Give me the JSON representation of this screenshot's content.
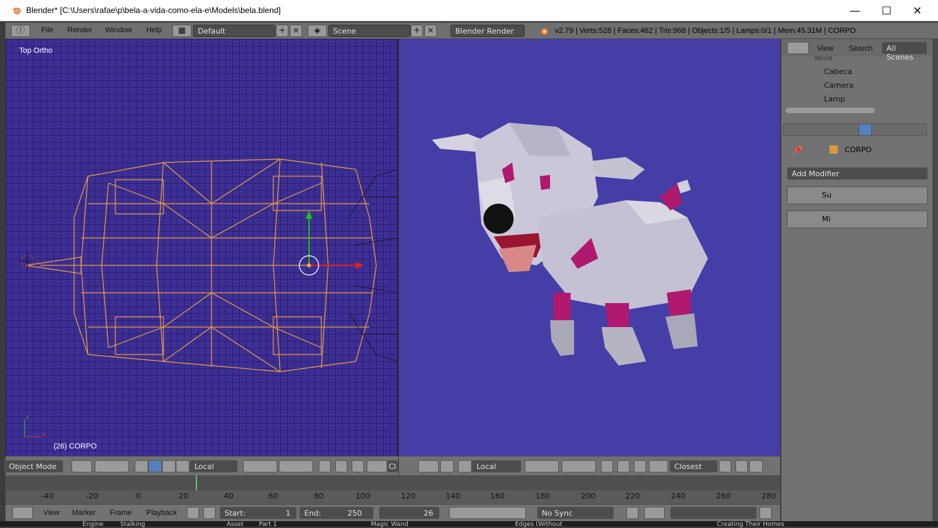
{
  "window": {
    "title": "Blender* [C:\\Users\\rafae\\p\\bela-a-vida-como-ela-e\\Models\\bela.blend]",
    "minimize": "—",
    "maximize": "☐",
    "close": "✕"
  },
  "menu": {
    "items": [
      "File",
      "Render",
      "Window",
      "Help"
    ],
    "layout": "Default",
    "scene": "Scene",
    "engine": "Blender Render",
    "status": "v2.79 | Verts:528 | Faces:462 | Tris:968 | Objects:1/5 | Lamps:0/1 | Mem:45.31M | CORPO"
  },
  "viewport_left": {
    "view_label": "Top Ortho",
    "object_label": "(26) CORPO",
    "mode": "Object Mode",
    "orientation": "Local",
    "axis_x": "x",
    "axis_y": "y"
  },
  "viewport_right": {
    "orientation": "Local",
    "snap": "Closest",
    "cut_label": "Cl"
  },
  "timeline": {
    "ticks": [
      "-40",
      "-20",
      "0",
      "20",
      "40",
      "60",
      "80",
      "100",
      "120",
      "140",
      "160",
      "180",
      "200",
      "220",
      "240",
      "260",
      "280"
    ],
    "current_frame_marker": 26
  },
  "bottombar": {
    "items": [
      "View",
      "Marker",
      "Frame",
      "Playback"
    ],
    "start_label": "Start:",
    "start_value": "1",
    "end_label": "End:",
    "end_value": "250",
    "current": "26",
    "sync": "No Sync"
  },
  "outliner": {
    "view": "View",
    "search": "Search",
    "filter": "All Scenes",
    "rows": [
      {
        "label": "World"
      },
      {
        "label": "Cabeca"
      },
      {
        "label": "Camera"
      },
      {
        "label": "Lamp"
      }
    ]
  },
  "properties": {
    "object_name": "CORPO",
    "add_modifier": "Add Modifier",
    "modifiers": [
      {
        "name": "Su"
      },
      {
        "name": "Mi"
      }
    ]
  },
  "taskbar_peek": [
    "Engine",
    "Stalking",
    "Asset",
    "Part 1",
    "Magic Wand",
    "Edges (Without",
    "Creating Their Homes"
  ],
  "colors": {
    "wire_selected": "#f5a340",
    "viewport_bg": "#3d2f95",
    "render_bg": "#443ea6",
    "dog_body": "#c9c7d8",
    "dog_pink": "#b0196e"
  }
}
